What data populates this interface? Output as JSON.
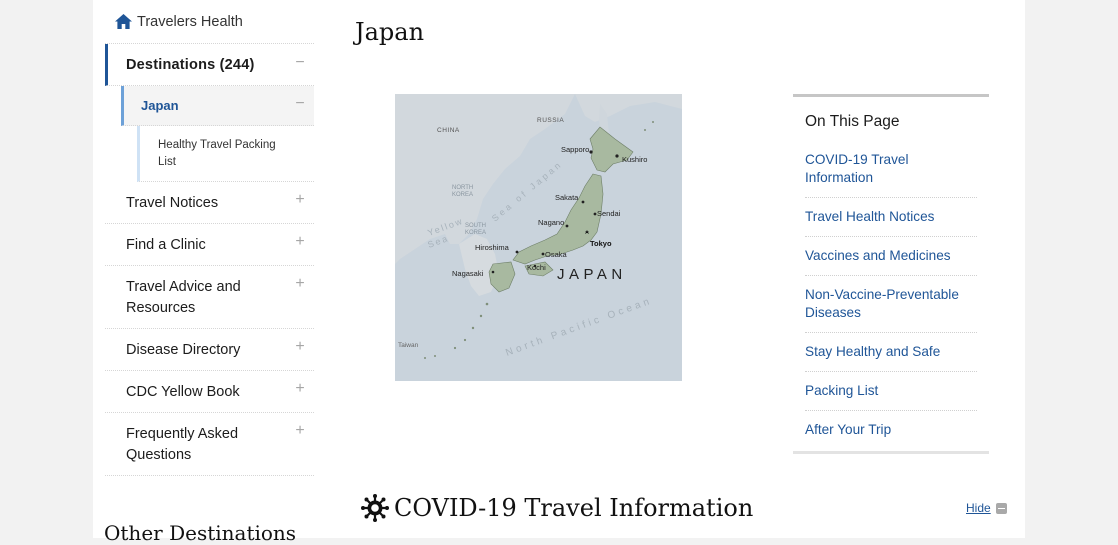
{
  "nav": {
    "home_label": "Travelers Health",
    "destinations_label": "Destinations (244)",
    "destinations_toggle": "−",
    "country_label": "Japan",
    "country_toggle": "−",
    "packing_label": "Healthy Travel Packing List",
    "items": [
      {
        "label": "Travel Notices",
        "toggle": "+"
      },
      {
        "label": "Find a Clinic",
        "toggle": "+"
      },
      {
        "label": "Travel Advice and Resources",
        "toggle": "+"
      },
      {
        "label": "Disease Directory",
        "toggle": "+"
      },
      {
        "label": "CDC Yellow Book",
        "toggle": "+"
      },
      {
        "label": "Frequently Asked Questions",
        "toggle": "+"
      }
    ],
    "other_destinations": "Other Destinations"
  },
  "main": {
    "title": "Japan",
    "map": {
      "labels": {
        "china": "CHINA",
        "russia": "RUSSIA",
        "north_korea_1": "NORTH",
        "north_korea_2": "KOREA",
        "south_korea_1": "SOUTH",
        "south_korea_2": "KOREA",
        "yellow_sea_1": "Yellow",
        "yellow_sea_2": "Sea",
        "sea_of_japan": "Sea of Japan",
        "sapporo": "Sapporo",
        "kushiro": "Kushiro",
        "sakata": "Sakata",
        "sendai": "Sendai",
        "nagano": "Nagano",
        "tokyo": "Tokyo",
        "osaka": "Osaka",
        "hiroshima": "Hiroshima",
        "kochi": "Kochi",
        "nagasaki": "Nagasaki",
        "taiwan": "Taiwan",
        "japan": "JAPAN",
        "pacific": "North Pacific Ocean"
      }
    },
    "covid_title": "COVID-19 Travel Information",
    "hide_label": "Hide"
  },
  "on_this_page": {
    "title": "On This Page",
    "items": [
      "COVID-19 Travel Information",
      "Travel Health Notices",
      "Vaccines and Medicines",
      "Non-Vaccine-Preventable Diseases",
      "Stay Healthy and Safe",
      "Packing List",
      "After Your Trip"
    ]
  },
  "colors": {
    "link": "#1f5597",
    "active_border": "#1f5597",
    "sub_border": "#6da1d8",
    "page_bg": "#f2f2f2"
  }
}
